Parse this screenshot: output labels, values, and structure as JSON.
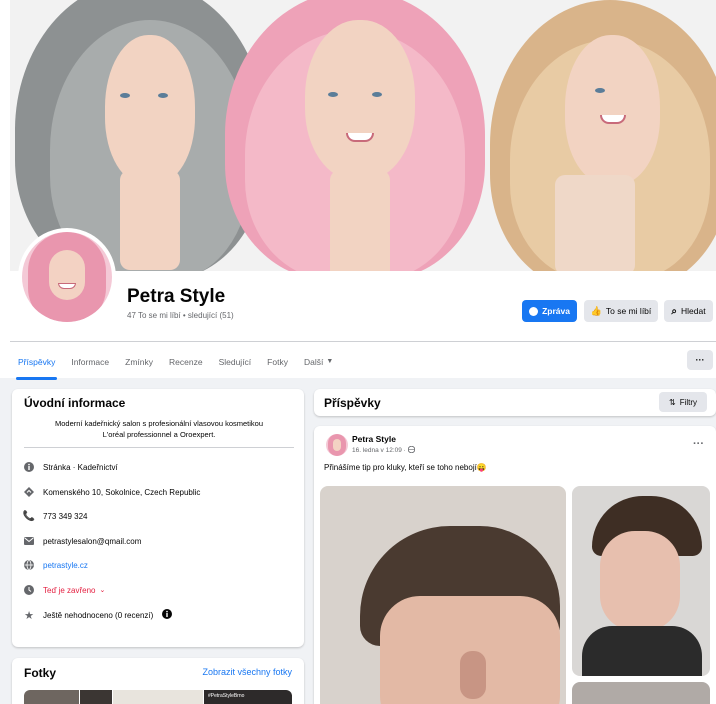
{
  "page": {
    "name": "Petra Style",
    "stats": "47 To se mi líbí • sledující (51)"
  },
  "actions": {
    "message": "Zpráva",
    "like": "To se mi líbí",
    "search": "Hledat"
  },
  "tabs": [
    {
      "label": "Příspěvky"
    },
    {
      "label": "Informace"
    },
    {
      "label": "Zmínky"
    },
    {
      "label": "Recenze"
    },
    {
      "label": "Sledující"
    },
    {
      "label": "Fotky"
    },
    {
      "label": "Další"
    }
  ],
  "more": "···",
  "intro": {
    "title": "Úvodní informace",
    "bio_line1": "Moderní kadeřnický salon s profesionální vlasovou kosmetikou",
    "bio_line2": "L'oréal professionnel a Oroexpert.",
    "items": [
      {
        "icon": "info-icon",
        "text": "Stránka · Kadeřnictví"
      },
      {
        "icon": "location-icon",
        "text": "Komenského 10, Sokolnice, Czech Republic"
      },
      {
        "icon": "phone-icon",
        "text": "773 349 324"
      },
      {
        "icon": "email-icon",
        "text": "petrastylesalon@qmail.com"
      },
      {
        "icon": "globe-icon",
        "text": "petrastyle.cz"
      },
      {
        "icon": "clock-icon",
        "text": "Teď je zavřeno"
      },
      {
        "icon": "star-icon",
        "text": "Ještě nehodnoceno (0 recenzí)"
      }
    ]
  },
  "photos": {
    "title": "Fotky",
    "see_all": "Zobrazit všechny fotky",
    "thumb_caption": "#PetraStyleBrno"
  },
  "posts": {
    "title": "Příspěvky",
    "filters": "Filtry"
  },
  "post": {
    "author": "Petra Style",
    "time": "16. ledna v 12:09 · ",
    "text": "Přinášíme tip pro kluky, kteří se toho nebojí",
    "emoji": "😛",
    "menu": "···"
  },
  "colors": {
    "accent": "#1877f2",
    "closed": "#e41e3f",
    "background": "#f0f2f5"
  }
}
